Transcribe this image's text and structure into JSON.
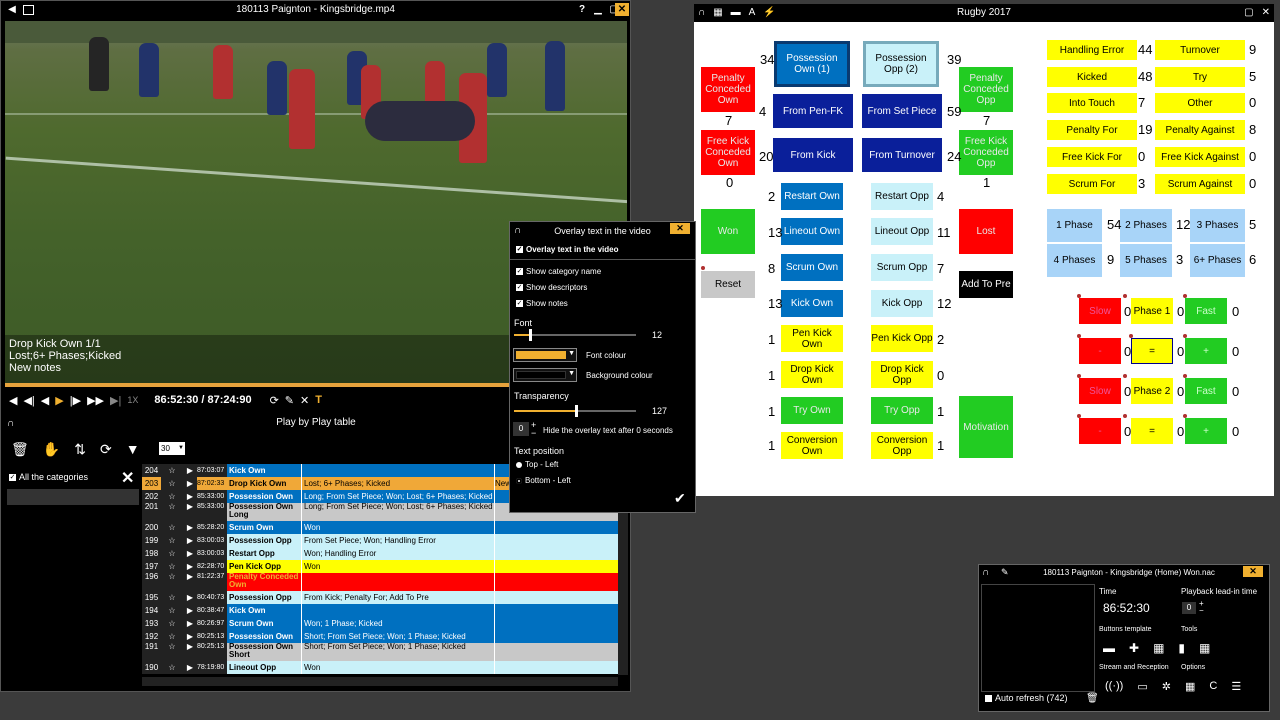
{
  "video_window": {
    "title": "180113 Paignton - Kingsbridge.mp4",
    "help": "?",
    "overlay_lines": [
      "Drop Kick Own 1/1",
      "Lost;6+ Phases;Kicked",
      "New notes"
    ],
    "progress_fraction": 0.99,
    "time_readout": "86:52:30 / 87:24:90",
    "speed_label": "1X"
  },
  "play_table": {
    "title": "Play by Play table",
    "page_size": "30",
    "all_categories_label": "All the categories",
    "rows": [
      {
        "num": "204",
        "time": "87:03:07",
        "cat": "Kick Own",
        "desc": "",
        "note": "",
        "style": "blue"
      },
      {
        "num": "203",
        "time": "87:02:33",
        "cat": "Drop Kick Own",
        "desc": "Lost; 6+ Phases; Kicked",
        "note": "New",
        "style": "orange"
      },
      {
        "num": "202",
        "time": "85:33:00",
        "cat": "Possession Own",
        "desc": "Long; From Set Piece; Won; Lost; 6+ Phases; Kicked",
        "note": "",
        "style": "blue"
      },
      {
        "num": "201",
        "time": "85:33:00",
        "cat": "Possession Own Long",
        "desc": "Long; From Set Piece; Won; Lost; 6+ Phases; Kicked",
        "note": "",
        "style": "grey"
      },
      {
        "num": "200",
        "time": "85:28:20",
        "cat": "Scrum Own",
        "desc": "Won",
        "note": "",
        "style": "blue"
      },
      {
        "num": "199",
        "time": "83:00:03",
        "cat": "Possession Opp",
        "desc": "From Set Piece; Won; Handling Error",
        "note": "",
        "style": "cyan"
      },
      {
        "num": "198",
        "time": "83:00:03",
        "cat": "Restart Opp",
        "desc": "Won; Handling Error",
        "note": "",
        "style": "cyan"
      },
      {
        "num": "197",
        "time": "82:28:70",
        "cat": "Pen Kick Opp",
        "desc": "Won",
        "note": "",
        "style": "yellow"
      },
      {
        "num": "196",
        "time": "81:22:37",
        "cat": "Penalty Conceded Own",
        "desc": "",
        "note": "",
        "style": "red"
      },
      {
        "num": "195",
        "time": "80:40:73",
        "cat": "Possession Opp",
        "desc": "From Kick; Penalty For; Add To Pre",
        "note": "",
        "style": "cyan"
      },
      {
        "num": "194",
        "time": "80:38:47",
        "cat": "Kick Own",
        "desc": "",
        "note": "",
        "style": "blue"
      },
      {
        "num": "193",
        "time": "80:26:97",
        "cat": "Scrum Own",
        "desc": "Won; 1 Phase; Kicked",
        "note": "",
        "style": "blue"
      },
      {
        "num": "192",
        "time": "80:25:13",
        "cat": "Possession Own",
        "desc": "Short; From Set Piece; Won; 1 Phase; Kicked",
        "note": "",
        "style": "blue"
      },
      {
        "num": "191",
        "time": "80:25:13",
        "cat": "Possession Own Short",
        "desc": "Short; From Set Piece; Won; 1 Phase; Kicked",
        "note": "",
        "style": "grey"
      },
      {
        "num": "190",
        "time": "78:19:80",
        "cat": "Lineout Opp",
        "desc": "Won",
        "note": "",
        "style": "cyan"
      }
    ]
  },
  "code_window": {
    "title": "Rugby 2017",
    "buttons": {
      "possession_own": "Possession Own (1)",
      "possession_opp": "Possession Opp (2)",
      "penalty_conceded_own": "Penalty Conceded Own",
      "penalty_conceded_opp": "Penalty Conceded Opp",
      "free_kick_conceded_own": "Free Kick Conceded Own",
      "free_kick_conceded_opp": "Free Kick Conceded Opp",
      "from_pen_fk": "From Pen-FK",
      "from_set_piece": "From Set Piece",
      "from_kick": "From Kick",
      "from_turnover": "From Turnover",
      "restart_own": "Restart Own",
      "restart_opp": "Restart Opp",
      "lineout_own": "Lineout Own",
      "lineout_opp": "Lineout Opp",
      "scrum_own": "Scrum Own",
      "scrum_opp": "Scrum Opp",
      "kick_own": "Kick Own",
      "kick_opp": "Kick Opp",
      "pen_kick_own": "Pen Kick Own",
      "pen_kick_opp": "Pen Kick Opp",
      "drop_kick_own": "Drop Kick Own",
      "drop_kick_opp": "Drop Kick Opp",
      "try_own": "Try Own",
      "try_opp": "Try Opp",
      "conversion_own": "Conversion Own",
      "conversion_opp": "Conversion Opp",
      "won": "Won",
      "lost": "Lost",
      "reset": "Reset",
      "add_to_pre": "Add To Pre",
      "motivation": "Motivation",
      "handling_error": "Handling Error",
      "turnover": "Turnover",
      "kicked": "Kicked",
      "try": "Try",
      "into_touch": "Into Touch",
      "other": "Other",
      "penalty_for": "Penalty For",
      "penalty_against": "Penalty Against",
      "free_kick_for": "Free Kick For",
      "free_kick_against": "Free Kick Against",
      "scrum_for": "Scrum For",
      "scrum_against": "Scrum Against",
      "phase_1": "1 Phase",
      "phases_2": "2 Phases",
      "phases_3": "3 Phases",
      "phases_4": "4 Phases",
      "phases_5": "5 Phases",
      "phases_6": "6+ Phases",
      "slow_1": "Slow",
      "phase1_mid": "Phase 1",
      "fast_1": "Fast",
      "red_a": "-",
      "yellow_a": "=",
      "green_a": "+",
      "slow_2": "Slow",
      "phase2_mid": "Phase 2",
      "fast_2": "Fast",
      "red_b": "-",
      "yellow_b": "=",
      "green_b": "+"
    },
    "counts": {
      "possession_own": "34",
      "possession_opp": "39",
      "penalty_conceded_own": "7",
      "penalty_conceded_opp": "7",
      "free_kick_own": "0",
      "free_kick_opp": "1",
      "from_pen_fk": "4",
      "from_set_piece": "59",
      "from_kick": "20",
      "from_turnover": "24",
      "restart_own": "2",
      "restart_opp": "4",
      "lineout_own": "13",
      "lineout_opp": "11",
      "scrum_own": "8",
      "scrum_opp": "7",
      "kick_own": "13",
      "kick_opp": "12",
      "pen_kick_own": "1",
      "pen_kick_opp": "2",
      "drop_kick_own": "1",
      "drop_kick_opp": "0",
      "try_own": "1",
      "try_opp": "1",
      "conversion_own": "1",
      "conversion_opp": "1",
      "handling_error": "44",
      "turnover": "9",
      "kicked": "48",
      "try": "5",
      "into_touch": "7",
      "other": "0",
      "penalty_for": "19",
      "penalty_against": "8",
      "free_kick_for": "0",
      "free_kick_against": "0",
      "scrum_for": "3",
      "scrum_against": "0",
      "phase_1": "54",
      "phases_2": "12",
      "phases_3": "5",
      "phases_4": "9",
      "phases_5": "3",
      "phases_6": "6",
      "slow_1": "0",
      "phase1_mid": "0",
      "fast_1": "0",
      "red_a": "0",
      "yellow_a": "0",
      "green_a": "0",
      "slow_2": "0",
      "phase2_mid": "0",
      "fast_2": "0",
      "red_b": "0",
      "yellow_b": "0",
      "green_b": "0"
    }
  },
  "overlay_dialog": {
    "title": "Overlay text in the video",
    "enable_label": "Overlay text in the video",
    "show_category": "Show category name",
    "show_descriptors": "Show descriptors",
    "show_notes": "Show notes",
    "font_label": "Font",
    "font_size": "12",
    "font_size_fraction": 0.12,
    "font_colour_label": "Font colour",
    "background_colour_label": "Background colour",
    "font_colour": "#f0b030",
    "background_colour": "#000000",
    "transparency_label": "Transparency",
    "transparency_value": "127",
    "transparency_fraction": 0.5,
    "hide_value": "0",
    "hide_label": "Hide the overlay text after 0 seconds",
    "text_position_label": "Text position",
    "pos_top_left": "Top - Left",
    "pos_bottom_left": "Bottom - Left"
  },
  "mini_window": {
    "title": "180113 Paignton - Kingsbridge (Home) Won.nac",
    "time_label": "Time",
    "time_value": "86:52:30",
    "leadin_label": "Playback lead-in time",
    "leadin_value": "0",
    "buttons_template_label": "Buttons template",
    "tools_label": "Tools",
    "stream_label": "Stream and Reception",
    "options_label": "Options",
    "auto_refresh_label": "Auto refresh (742)"
  },
  "colors": {
    "blue": "#0070c0",
    "cyan": "#c9f1f9",
    "orange": "#f0a838",
    "grey": "#c8c8c8",
    "yellow": "#ffff00",
    "red": "#ff0000",
    "green": "#22cc22",
    "navy": "#0a1f9a",
    "lightblue": "#a8d4f8"
  }
}
